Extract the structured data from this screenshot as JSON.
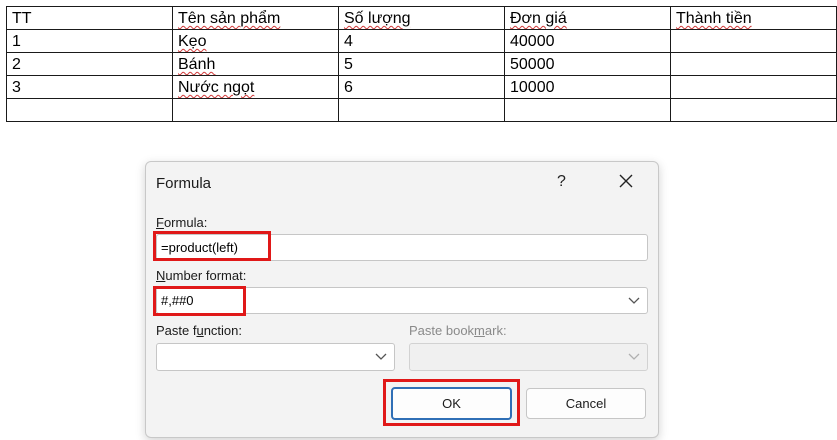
{
  "table": {
    "headers": [
      "TT",
      "Tên sản phẩm",
      "Số lượng",
      "Đơn giá",
      "Thành tiền"
    ],
    "rows": [
      [
        "1",
        "Kẹo",
        "4",
        "40000",
        ""
      ],
      [
        "2",
        "Bánh",
        "5",
        "50000",
        ""
      ],
      [
        "3",
        "Nước ngọt",
        "6",
        "10000",
        ""
      ],
      [
        "",
        "",
        "",
        "",
        ""
      ]
    ]
  },
  "dialog": {
    "title": "Formula",
    "help": "?",
    "formula": {
      "label_first": "F",
      "label_rest": "ormula:",
      "value": "=product(left)"
    },
    "number_format": {
      "label_first": "N",
      "label_rest": "umber format:",
      "value": "#,##0"
    },
    "paste_function": {
      "label_pre": "Paste f",
      "label_acc": "u",
      "label_post": "nction:",
      "value": ""
    },
    "paste_bookmark": {
      "label_pre": "Paste book",
      "label_acc": "m",
      "label_post": "ark:",
      "value": ""
    },
    "ok_label": "OK",
    "cancel_label": "Cancel"
  },
  "colors": {
    "highlight": "#e01818",
    "primary_border": "#2f6fb6",
    "spell_squiggle": "#d03a3a"
  }
}
